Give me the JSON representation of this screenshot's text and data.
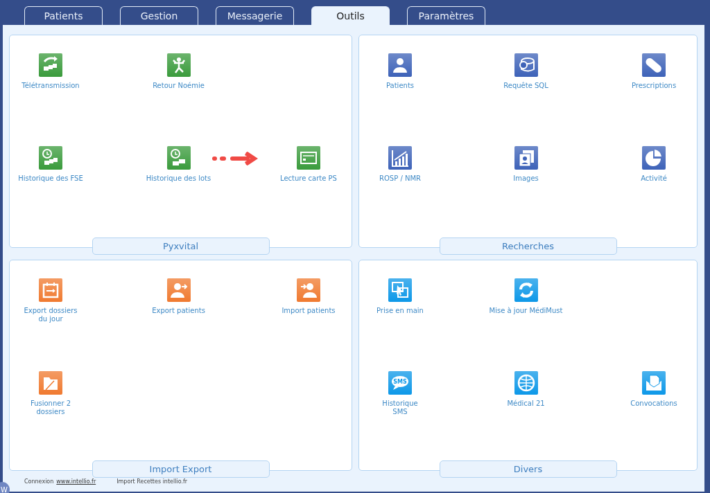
{
  "tabs": [
    {
      "label": "Patients",
      "selected": false
    },
    {
      "label": "Gestion",
      "selected": false
    },
    {
      "label": "Messagerie",
      "selected": false
    },
    {
      "label": "Outils",
      "selected": true
    },
    {
      "label": "Paramètres",
      "selected": false
    }
  ],
  "groups": [
    {
      "title": "Pyxvital",
      "color": "#3a9b3c",
      "rows": [
        [
          {
            "kind": "tool",
            "label": "Télétransmission"
          },
          {
            "kind": "tool",
            "label": "Retour Noémie"
          },
          {
            "kind": "blank"
          }
        ],
        [
          {
            "kind": "tool",
            "label": "Historique des FSE"
          },
          {
            "kind": "tool",
            "label": "Historique des lots"
          },
          {
            "kind": "tool",
            "label": "Lecture carte PS"
          }
        ]
      ]
    },
    {
      "title": "Recherches",
      "color": "#3d62b8",
      "rows": [
        [
          {
            "kind": "tool",
            "label": "Patients"
          },
          {
            "kind": "tool",
            "label": "Requête SQL"
          },
          {
            "kind": "tool",
            "label": "Prescriptions"
          }
        ],
        [
          {
            "kind": "tool",
            "label": "ROSP / NMR"
          },
          {
            "kind": "tool",
            "label": "Images"
          },
          {
            "kind": "tool",
            "label": "Activité"
          }
        ]
      ]
    },
    {
      "title": "Import Export",
      "color": "#f07a30",
      "rows": [
        [
          {
            "kind": "tool",
            "label": "Export dossiers\ndu jour"
          },
          {
            "kind": "tool",
            "label": "Export patients"
          },
          {
            "kind": "tool",
            "label": "Import patients"
          }
        ],
        [
          {
            "kind": "tool",
            "label": "Fusionner 2\ndossiers"
          },
          {
            "kind": "blank"
          },
          {
            "kind": "blank"
          }
        ]
      ]
    },
    {
      "title": "Divers",
      "color": "#0d98e8",
      "rows": [
        [
          {
            "kind": "tool",
            "label": "Prise en main"
          },
          {
            "kind": "tool",
            "label": "Mise à jour MédiMust"
          },
          {
            "kind": "blank"
          }
        ],
        [
          {
            "kind": "tool",
            "label": "Historique\nSMS",
            "icon_text": "SMS"
          },
          {
            "kind": "tool",
            "label": "Médical 21"
          },
          {
            "kind": "tool",
            "label": "Convocations"
          }
        ]
      ]
    }
  ],
  "footer": {
    "corner_badge": "W",
    "connexion_label": "Connexion",
    "connexion_link": "www.intellio.fr",
    "import_link": "Import Recettes intellio.fr"
  }
}
